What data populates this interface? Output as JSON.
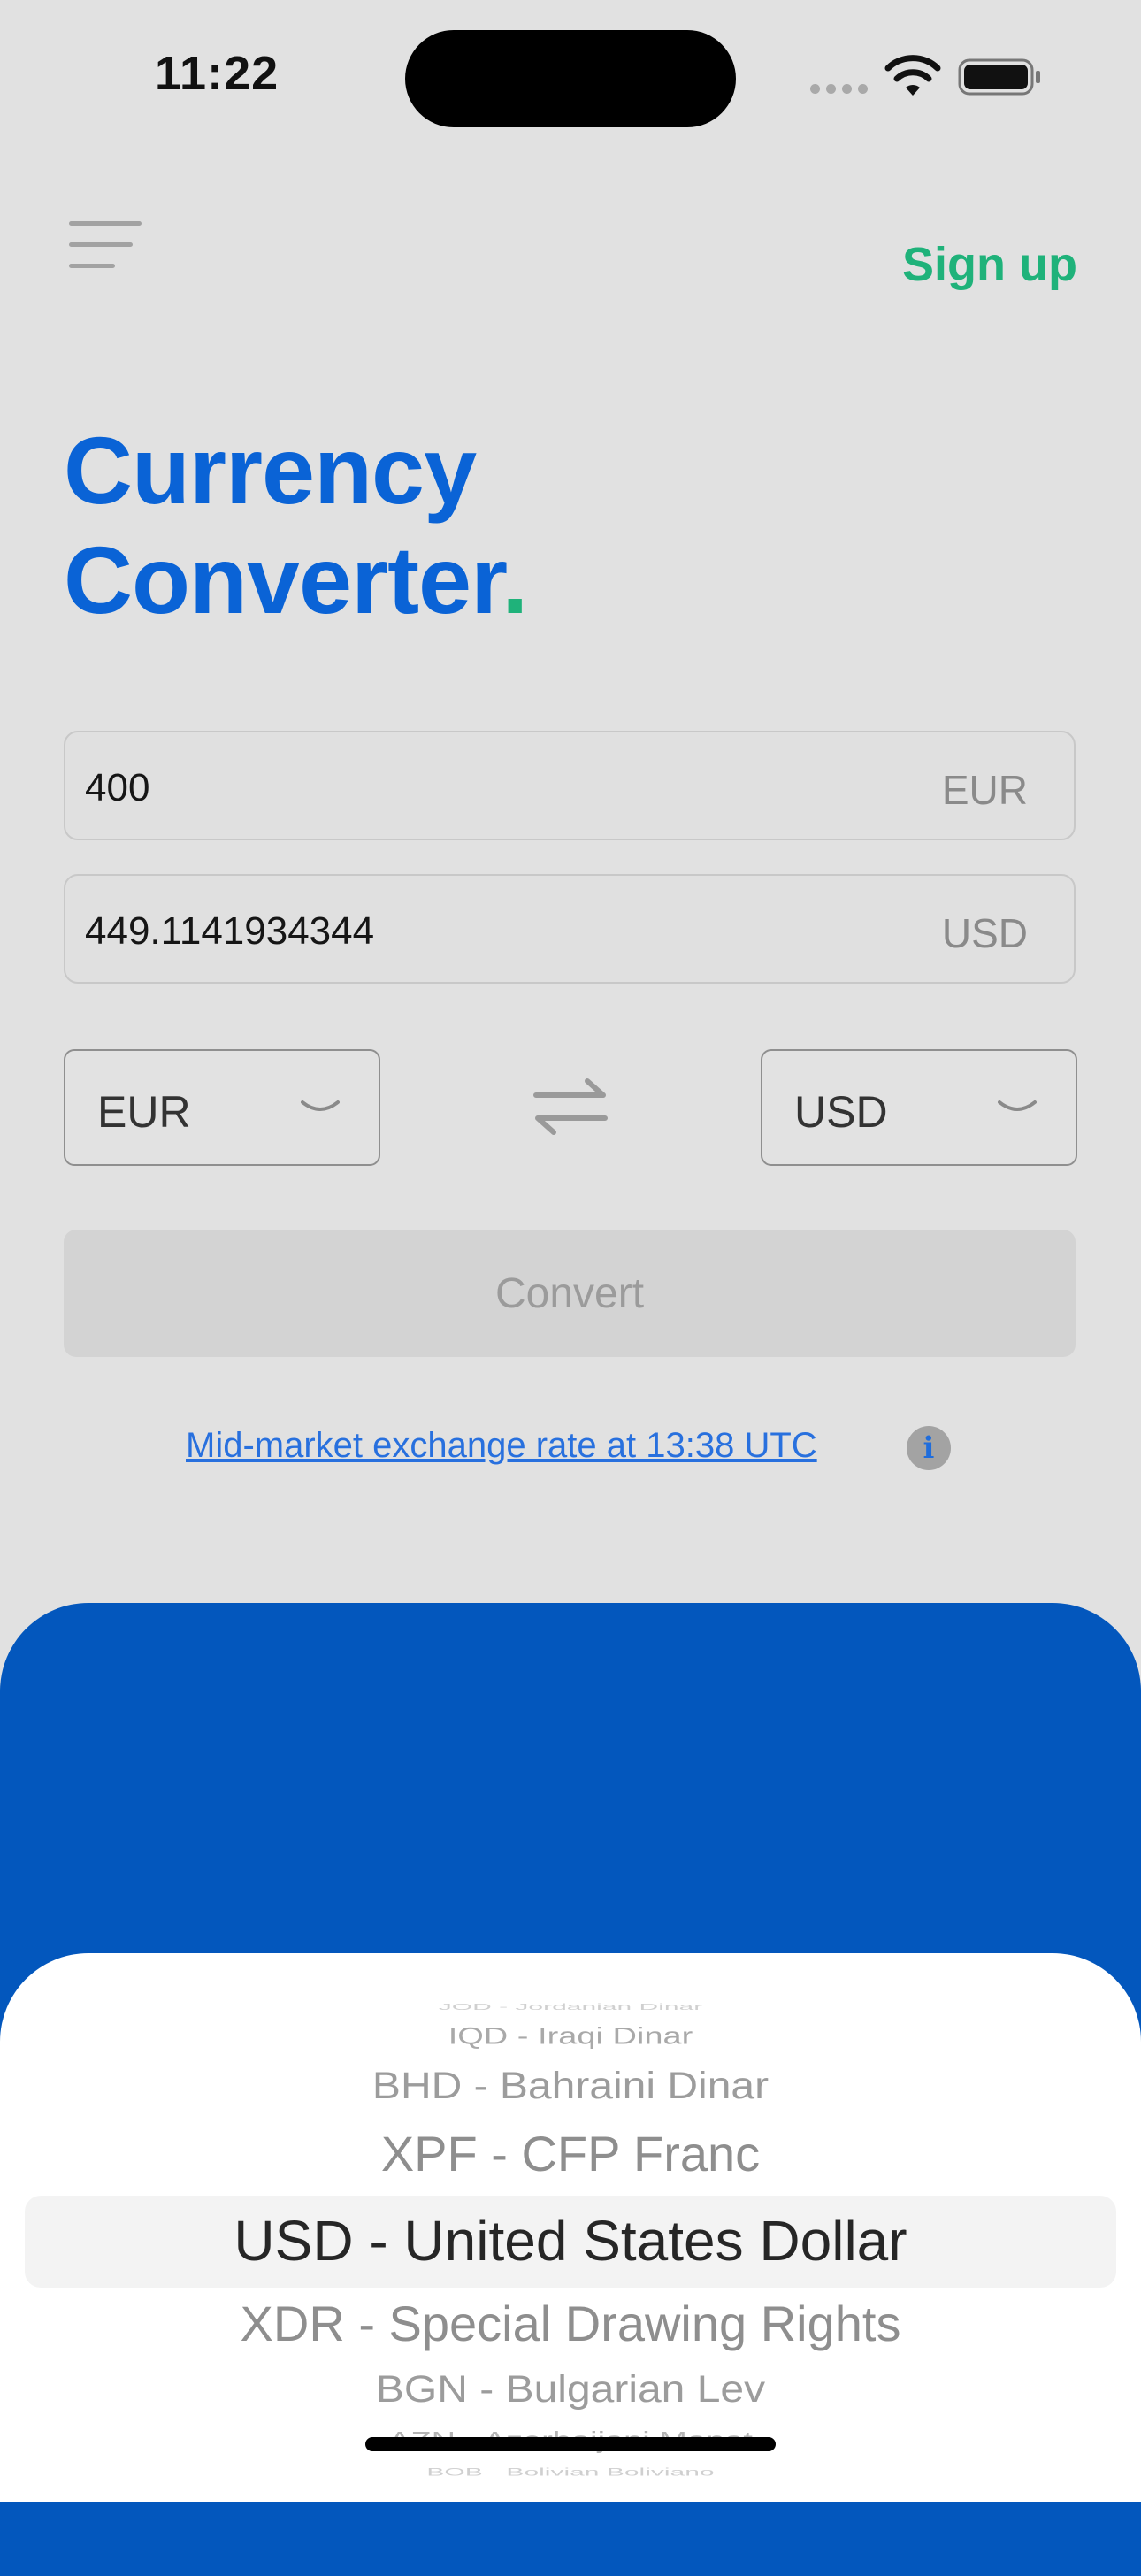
{
  "status": {
    "time": "11:22"
  },
  "header": {
    "signup_label": "Sign up"
  },
  "title": {
    "line1": "Currency",
    "line2": "Converter",
    "dot": "."
  },
  "converter": {
    "amount_value": "400",
    "amount_currency": "EUR",
    "result_value": "449.1141934344",
    "result_currency": "USD",
    "from_select": "EUR",
    "to_select": "USD",
    "convert_label": "Convert",
    "rate_link": "Mid-market exchange rate at 13:38 UTC",
    "info_glyph": "i"
  },
  "picker": {
    "items": [
      "JOD - Jordanian Dinar",
      "IQD - Iraqi Dinar",
      "BHD - Bahraini Dinar",
      "XPF - CFP Franc",
      "USD - United States Dollar",
      "XDR - Special Drawing Rights",
      "BGN - Bulgarian Lev",
      "AZN - Azerbaijani Manat",
      "BOB - Bolivian Boliviano"
    ],
    "selected_index": 4
  },
  "colors": {
    "accent_blue": "#0a63d6",
    "accent_green": "#1fb27a",
    "panel_blue": "#0357bd",
    "background": "#e1e1e1"
  }
}
